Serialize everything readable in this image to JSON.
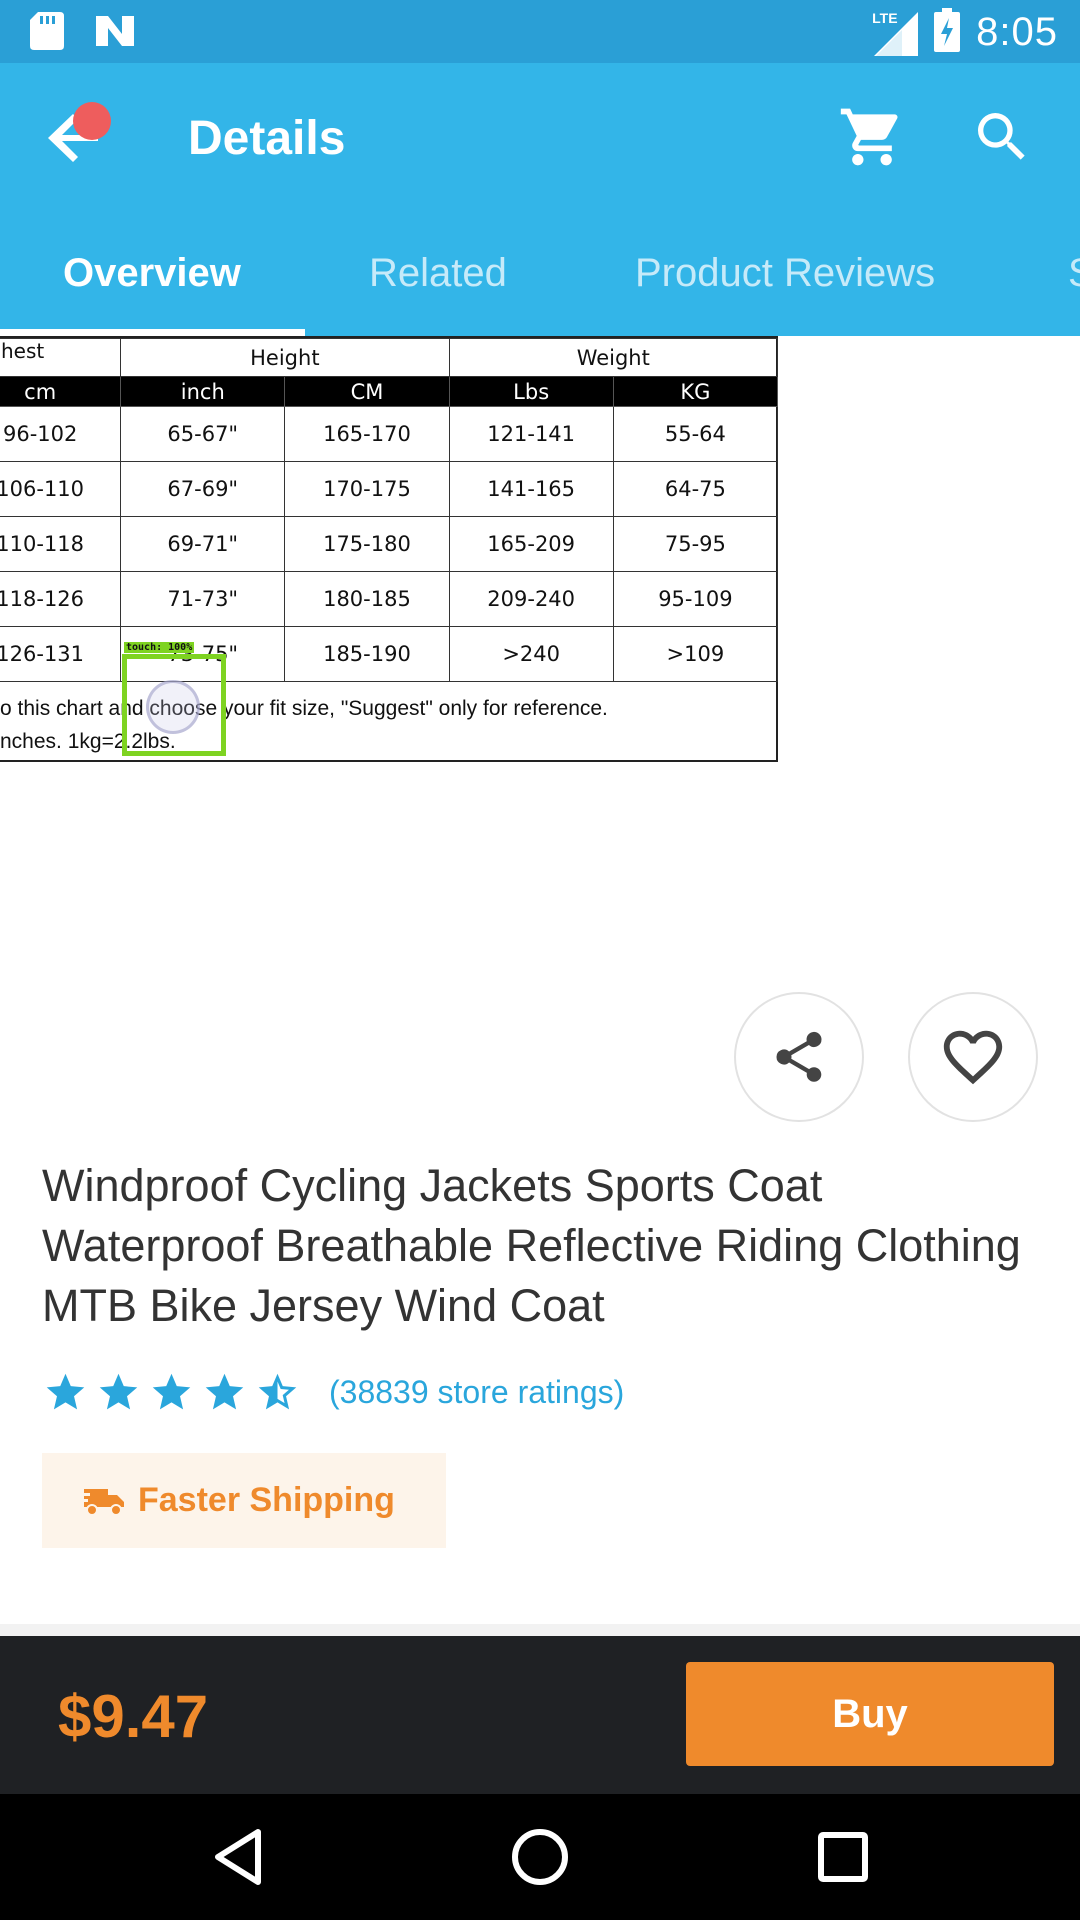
{
  "status_bar": {
    "time": "8:05",
    "network": "LTE",
    "icons": [
      "sd-card-icon",
      "n-notification-icon",
      "lte-signal-icon",
      "battery-charging-icon"
    ]
  },
  "app_bar": {
    "title": "Details",
    "icons": [
      "back-arrow-icon",
      "cart-icon",
      "search-icon"
    ]
  },
  "tabs": [
    {
      "label": "Overview",
      "active": true
    },
    {
      "label": "Related",
      "active": false
    },
    {
      "label": "Product Reviews",
      "active": false
    },
    {
      "label": "S",
      "active": false
    }
  ],
  "size_chart": {
    "header_partial": "hest",
    "group_headers": [
      "Height",
      "Weight"
    ],
    "columns": [
      "cm",
      "inch",
      "CM",
      "Lbs",
      "KG"
    ],
    "rows": [
      [
        "96-102",
        "65-67\"",
        "165-170",
        "121-141",
        "55-64"
      ],
      [
        "106-110",
        "67-69\"",
        "170-175",
        "141-165",
        "64-75"
      ],
      [
        "110-118",
        "69-71\"",
        "175-180",
        "165-209",
        "75-95"
      ],
      [
        "118-126",
        "71-73\"",
        "180-185",
        "209-240",
        "95-109"
      ],
      [
        "126-131",
        "73-75\"",
        "185-190",
        ">240",
        ">109"
      ]
    ],
    "note_line1": "o this chart and choose your fit size, \"Suggest\" only for reference.",
    "note_line2": "nches. 1kg=2.2lbs.",
    "touch_label": "touch: 100%"
  },
  "product": {
    "title": "Windproof Cycling Jackets Sports Coat Waterproof Breathable Reflective Riding Clothing MTB Bike Jersey Wind Coat",
    "rating_stars": 4.5,
    "ratings_text": "(38839 store ratings)",
    "shipping_label": "Faster Shipping"
  },
  "buy_bar": {
    "price": "$9.47",
    "buy_label": "Buy"
  },
  "colors": {
    "primary": "#33b5e8",
    "status_bar": "#2a9fd6",
    "accent_orange": "#ef8a2c",
    "star_blue": "#2aa6dc",
    "dark_bar": "#1f2124"
  }
}
